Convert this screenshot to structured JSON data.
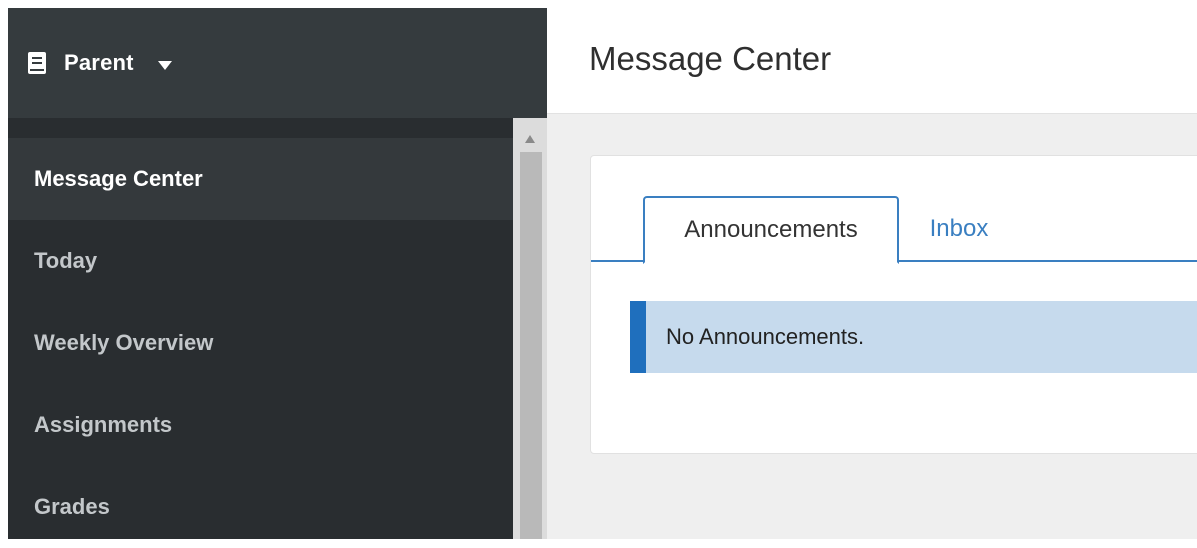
{
  "sidebar": {
    "role_label": "Parent",
    "role_icon": "book-icon",
    "items": [
      {
        "label": "Message Center",
        "active": true
      },
      {
        "label": "Today"
      },
      {
        "label": "Weekly Overview"
      },
      {
        "label": "Assignments"
      },
      {
        "label": "Grades"
      }
    ]
  },
  "header": {
    "title": "Message Center"
  },
  "tabs": [
    {
      "label": "Announcements",
      "active": true
    },
    {
      "label": "Inbox"
    }
  ],
  "notice": {
    "text": "No Announcements."
  },
  "colors": {
    "sidebar_bg": "#292d30",
    "sidebar_header_bg": "#353b3e",
    "accent": "#3a7fc1",
    "notice_bg": "#c6daed",
    "notice_border": "#1f6fbd"
  }
}
